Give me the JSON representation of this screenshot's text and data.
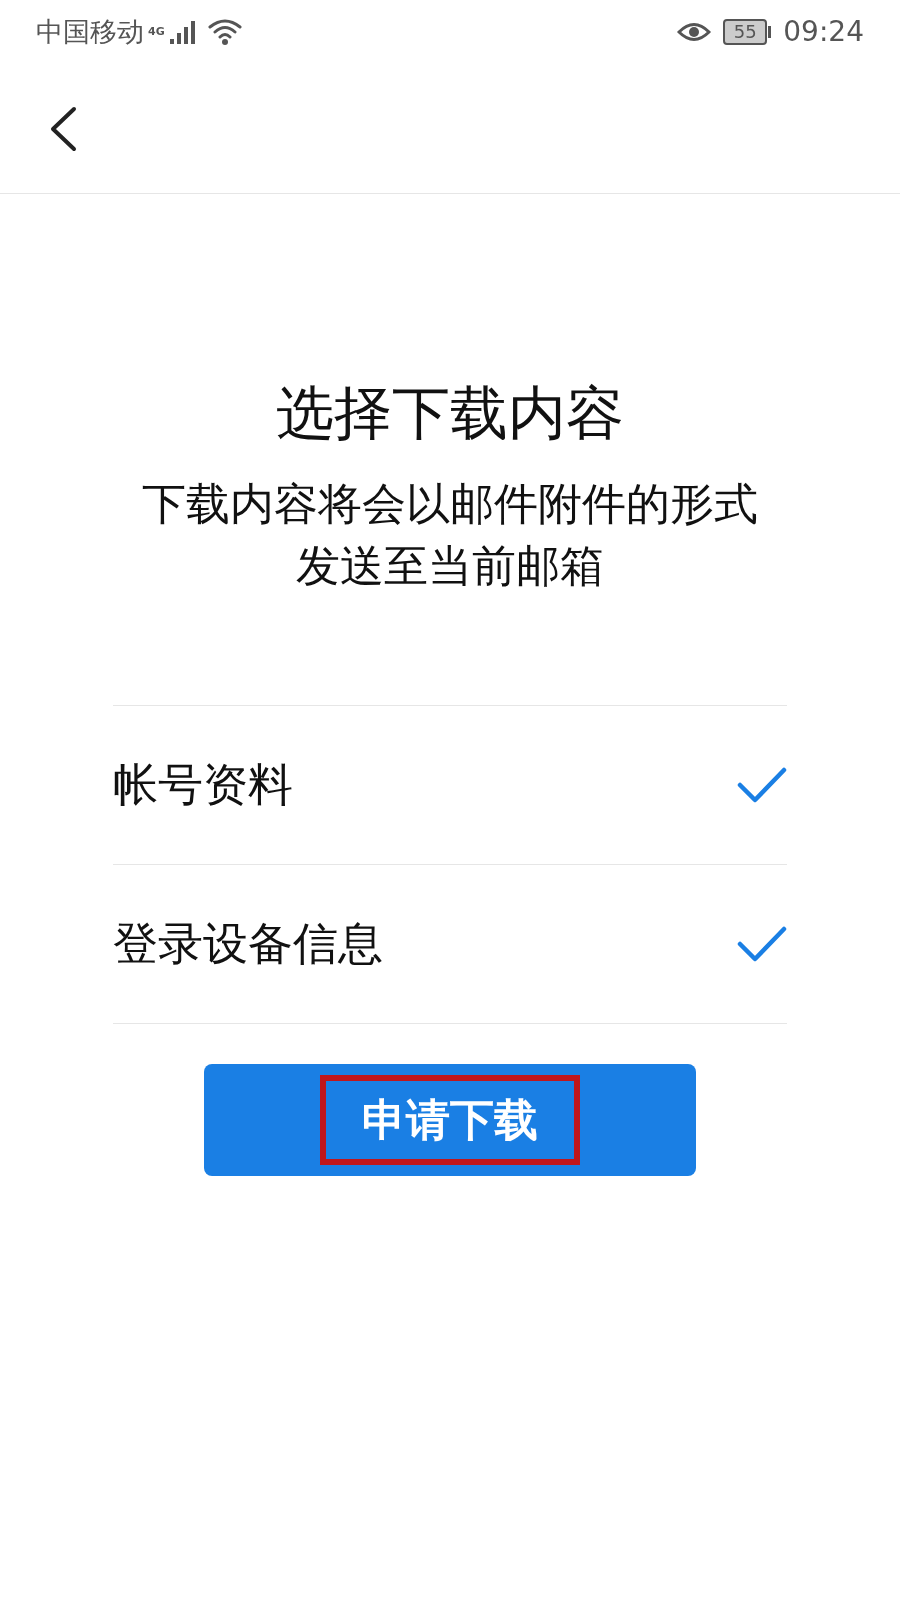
{
  "status_bar": {
    "carrier": "中国移动",
    "network": "4G",
    "battery": "55",
    "time": "09:24"
  },
  "title": "选择下载内容",
  "subtitle": [
    "下载内容将会以邮件附件的形式",
    "发送至当前邮箱"
  ],
  "options": [
    {
      "label": "帐号资料",
      "checked": true
    },
    {
      "label": "登录设备信息",
      "checked": true
    }
  ],
  "button": {
    "label": "申请下载",
    "highlighted": true
  }
}
